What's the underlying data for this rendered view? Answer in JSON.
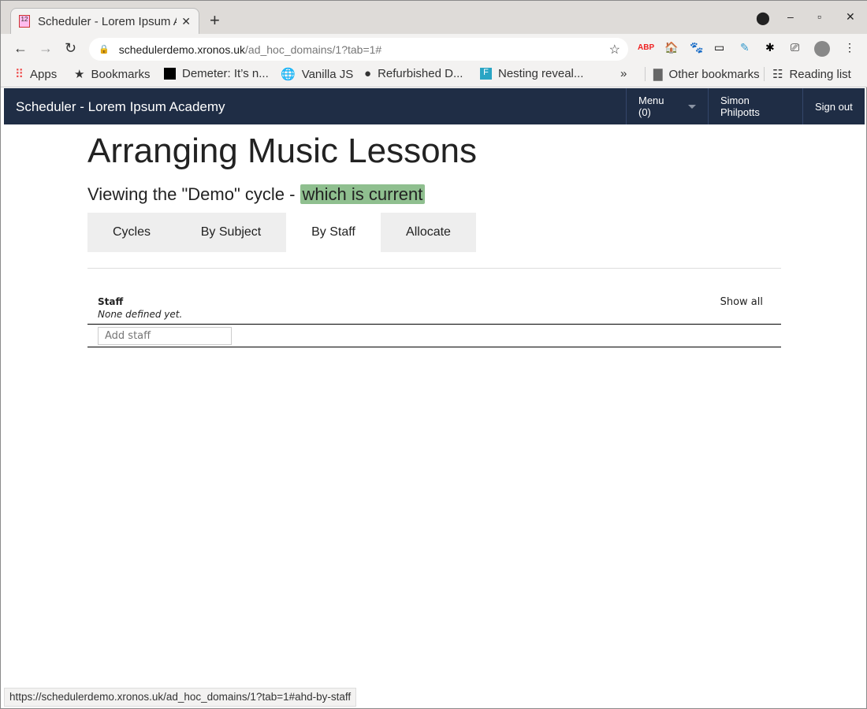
{
  "browser": {
    "tab_title": "Scheduler - Lorem Ipsum Academy",
    "url_host": "schedulerdemo.xronos.uk",
    "url_path": "/ad_hoc_domains/1?tab=1#",
    "bookmarks": [
      "Apps",
      "Bookmarks",
      "Demeter: It’s n...",
      "Vanilla JS",
      "Refurbished D...",
      "Nesting reveal..."
    ],
    "overflow": "»",
    "other_bookmarks": "Other bookmarks",
    "reading_list": "Reading list",
    "status_url": "https://schedulerdemo.xronos.uk/ad_hoc_domains/1?tab=1#ahd-by-staff"
  },
  "navbar": {
    "brand": "Scheduler - Lorem Ipsum Academy",
    "menu": "Menu (0)",
    "user": "Simon Philpotts",
    "sign_out": "Sign out",
    "bg": "#1f2d45"
  },
  "page": {
    "title": "Arranging Music Lessons",
    "subtitle": "Viewing the \"Demo\" cycle - ",
    "current_badge": "which is current",
    "badge_color": "#8fbf8f",
    "tabs": [
      {
        "label": "Cycles",
        "active": false
      },
      {
        "label": "By Subject",
        "active": false
      },
      {
        "label": "By Staff",
        "active": true
      },
      {
        "label": "Allocate",
        "active": false
      }
    ]
  },
  "staff": {
    "heading": "Staff",
    "show_all": "Show all",
    "empty": "None defined yet.",
    "add_placeholder": "Add staff"
  }
}
